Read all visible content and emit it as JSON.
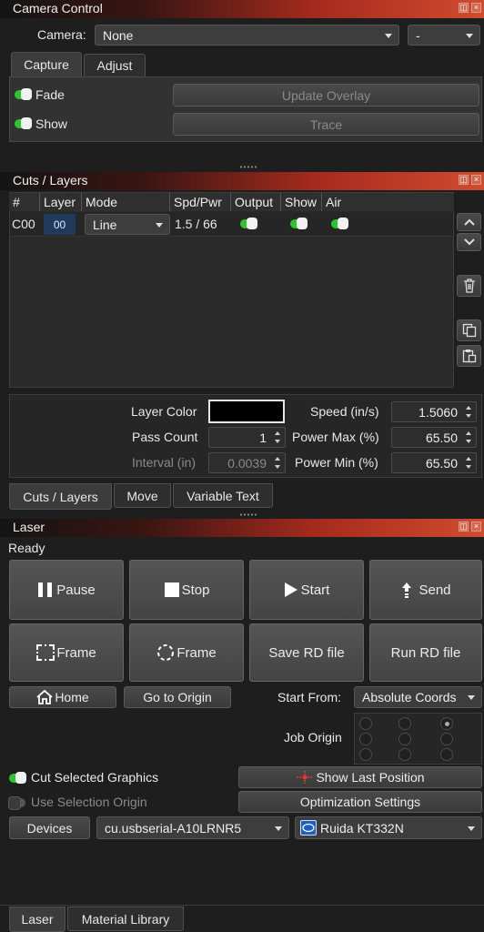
{
  "camera_panel": {
    "title": "Camera Control",
    "camera_label": "Camera:",
    "camera_value": "None",
    "camera_secondary": "-",
    "tabs": [
      "Capture",
      "Adjust"
    ],
    "fade_label": "Fade",
    "show_label": "Show",
    "update_overlay": "Update Overlay",
    "trace": "Trace"
  },
  "cuts_panel": {
    "title": "Cuts / Layers",
    "columns": [
      "#",
      "Layer",
      "Mode",
      "Spd/Pwr",
      "Output",
      "Show",
      "Air"
    ],
    "rows": [
      {
        "num": "C00",
        "layer": "00",
        "mode": "Line",
        "spd_pwr": "1.5 / 66"
      }
    ],
    "layer_color_label": "Layer Color",
    "pass_count_label": "Pass Count",
    "pass_count": "1",
    "interval_label": "Interval (in)",
    "interval": "0.0039",
    "speed_label": "Speed (in/s)",
    "speed": "1.5060",
    "power_max_label": "Power Max (%)",
    "power_max": "65.50",
    "power_min_label": "Power Min (%)",
    "power_min": "65.50",
    "tabs": [
      "Cuts / Layers",
      "Move",
      "Variable Text"
    ]
  },
  "laser_panel": {
    "title": "Laser",
    "status": "Ready",
    "pause": "Pause",
    "stop": "Stop",
    "start": "Start",
    "send": "Send",
    "frame1": "Frame",
    "frame2": "Frame",
    "save_rd": "Save RD file",
    "run_rd": "Run RD file",
    "home": "Home",
    "go_to_origin": "Go to Origin",
    "start_from_label": "Start From:",
    "start_from_value": "Absolute Coords",
    "job_origin_label": "Job Origin",
    "cut_selected": "Cut Selected Graphics",
    "use_selection_origin": "Use Selection Origin",
    "show_last_position": "Show Last Position",
    "optimization_settings": "Optimization Settings",
    "devices": "Devices",
    "port_value": "cu.usbserial-A10LRNR5",
    "controller_value": "Ruida KT332N",
    "bottom_tabs": [
      "Laser",
      "Material Library"
    ]
  },
  "colors": {
    "accent_green": "#2cc52c",
    "layer_swatch": "#000000",
    "layer_00_bg": "#1f3a5a"
  }
}
